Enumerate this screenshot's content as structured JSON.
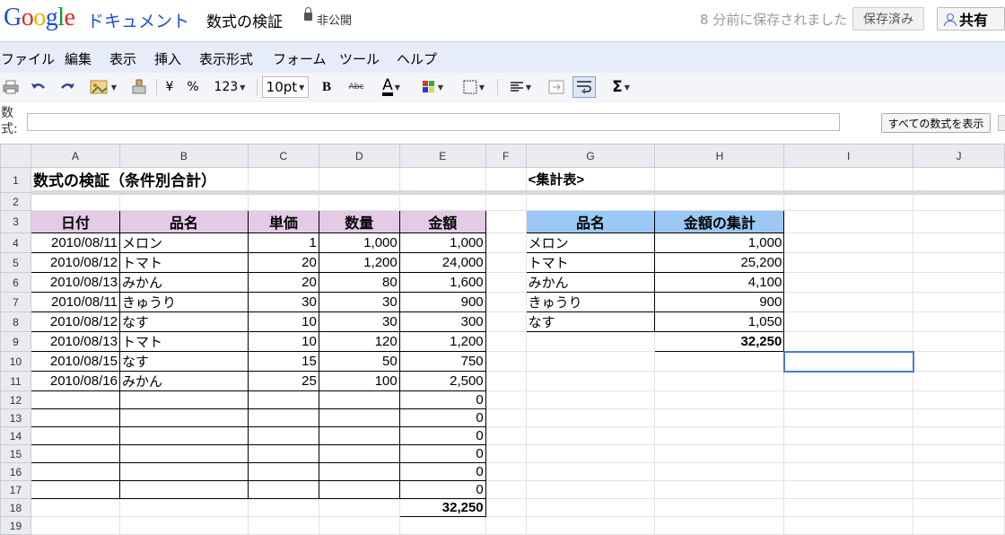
{
  "app": {
    "logo_parts": [
      "G",
      "o",
      "o",
      "g",
      "l",
      "e"
    ],
    "product": "ドキュメント",
    "title": "数式の検証",
    "privacy": "非公開",
    "saved_status": "8 分前に保存されました",
    "save_button": "保存済み",
    "share_button": "共有"
  },
  "menu": [
    "ファイル",
    "編集",
    "表示",
    "挿入",
    "表示形式",
    "フォーム",
    "ツール",
    "ヘルプ"
  ],
  "toolbar": {
    "currency": "¥",
    "percent": "%",
    "number_format": "123",
    "font_size": "10pt",
    "bold": "B",
    "strike": "Abc",
    "text_color": "A",
    "sum": "Σ"
  },
  "formula_bar": {
    "label": "数式:",
    "value": "",
    "show_all_button": "すべての数式を表示"
  },
  "columns": [
    "A",
    "B",
    "C",
    "D",
    "E",
    "F",
    "G",
    "H",
    "I",
    "J"
  ],
  "rows": [
    "1",
    "2",
    "3",
    "4",
    "5",
    "6",
    "7",
    "8",
    "9",
    "10",
    "11",
    "12",
    "13",
    "14",
    "15",
    "16",
    "17",
    "18",
    "19"
  ],
  "sheet": {
    "title": "数式の検証（条件別合計）",
    "summary_title": "<集計表>",
    "headers": [
      "日付",
      "品名",
      "単価",
      "数量",
      "金額"
    ],
    "data": [
      [
        "2010/08/11",
        "メロン",
        "1",
        "1,000",
        "1,000"
      ],
      [
        "2010/08/12",
        "トマト",
        "20",
        "1,200",
        "24,000"
      ],
      [
        "2010/08/13",
        "みかん",
        "20",
        "80",
        "1,600"
      ],
      [
        "2010/08/11",
        "きゅうり",
        "30",
        "30",
        "900"
      ],
      [
        "2010/08/12",
        "なす",
        "10",
        "30",
        "300"
      ],
      [
        "2010/08/13",
        "トマト",
        "10",
        "120",
        "1,200"
      ],
      [
        "2010/08/15",
        "なす",
        "15",
        "50",
        "750"
      ],
      [
        "2010/08/16",
        "みかん",
        "25",
        "100",
        "2,500"
      ],
      [
        "",
        "",
        "",
        "",
        "0"
      ],
      [
        "",
        "",
        "",
        "",
        "0"
      ],
      [
        "",
        "",
        "",
        "",
        "0"
      ],
      [
        "",
        "",
        "",
        "",
        "0"
      ],
      [
        "",
        "",
        "",
        "",
        "0"
      ],
      [
        "",
        "",
        "",
        "",
        "0"
      ]
    ],
    "total": "32,250",
    "summary_headers": [
      "品名",
      "金額の集計"
    ],
    "summary_rows": [
      [
        "メロン",
        "1,000"
      ],
      [
        "トマト",
        "25,200"
      ],
      [
        "みかん",
        "4,100"
      ],
      [
        "きゅうり",
        "900"
      ],
      [
        "なす",
        "1,050"
      ]
    ],
    "summary_total": "32,250"
  }
}
